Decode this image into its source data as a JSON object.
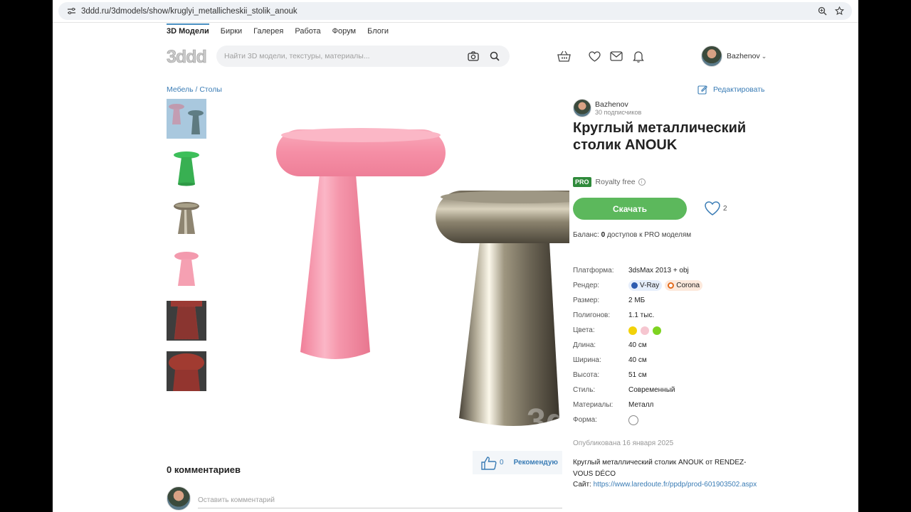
{
  "browser": {
    "url": "3ddd.ru/3dmodels/show/kruglyi_metallicheskii_stolik_anouk"
  },
  "nav": {
    "items": [
      "3D Модели",
      "Бирки",
      "Галерея",
      "Работа",
      "Форум",
      "Блоги"
    ]
  },
  "logo_text": "3ddd",
  "search": {
    "placeholder": "Найти 3D модели, текстуры, материалы..."
  },
  "user": {
    "name": "Bazhenov"
  },
  "breadcrumb": "Мебель / Столы",
  "edit_label": "Редактировать",
  "author": {
    "name": "Bazhenov",
    "subscribers": "30 подписчиков"
  },
  "title": "Круглый металлический столик ANOUK",
  "license": {
    "badge": "PRO",
    "label": "Royalty free"
  },
  "download_label": "Скачать",
  "likes": "2",
  "balance": {
    "prefix": "Баланс: ",
    "count": "0",
    "suffix": " доступов к PRO моделям"
  },
  "specs": {
    "platform": {
      "label": "Платформа:",
      "value": "3dsMax 2013 + obj"
    },
    "render": {
      "label": "Рендер:",
      "vray": "V-Ray",
      "corona": "Corona"
    },
    "size": {
      "label": "Размер:",
      "value": "2 МБ"
    },
    "polygons": {
      "label": "Полигонов:",
      "value": "1.1 тыс."
    },
    "colors": {
      "label": "Цвета:",
      "swatches": [
        "#f2d20a",
        "#f6c6d0",
        "#7ed321"
      ]
    },
    "length": {
      "label": "Длина:",
      "value": "40 см"
    },
    "width": {
      "label": "Ширина:",
      "value": "40 см"
    },
    "height": {
      "label": "Высота:",
      "value": "51 см"
    },
    "style": {
      "label": "Стиль:",
      "value": "Современный"
    },
    "materials": {
      "label": "Материалы:",
      "value": "Металл"
    },
    "form": {
      "label": "Форма:"
    }
  },
  "published": "Опубликована 16 января 2025",
  "description": {
    "text": "Круглый металлический столик ANOUK от RENDEZ-VOUS DÉCO",
    "site_label": "Сайт: ",
    "site_url": "https://www.laredoute.fr/ppdp/prod-601903502.aspx"
  },
  "recommend": {
    "count": "0",
    "label": "Рекомендую"
  },
  "comments": {
    "heading": "0 комментариев",
    "placeholder": "Оставить комментарий"
  },
  "colors": {
    "link": "#3a7cb5",
    "download": "#5cb85c",
    "pro": "#2f8a3b"
  }
}
